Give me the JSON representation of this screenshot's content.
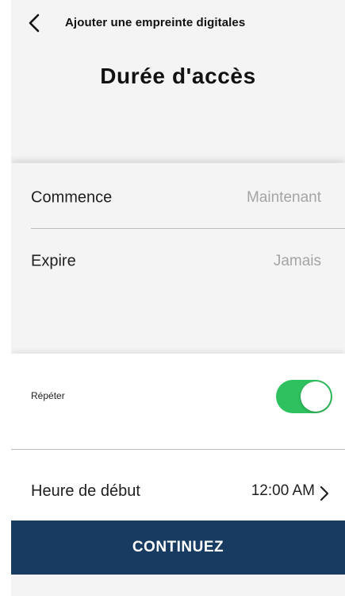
{
  "header": {
    "back_icon": "chevron-left-icon",
    "title": "Ajouter une empreinte digitales"
  },
  "page_title": "Durée d'accès",
  "access": {
    "starts_label": "Commence",
    "starts_value": "Maintenant",
    "expires_label": "Expire",
    "expires_value": "Jamais"
  },
  "repeat": {
    "label": "Répéter",
    "enabled": true,
    "toggle_color": "#2fc15f"
  },
  "start_time": {
    "label": "Heure de début",
    "value": "12:00 AM",
    "icon": "chevron-right-icon"
  },
  "continue_button": {
    "label": "CONTINUEZ",
    "color": "#173b61"
  }
}
